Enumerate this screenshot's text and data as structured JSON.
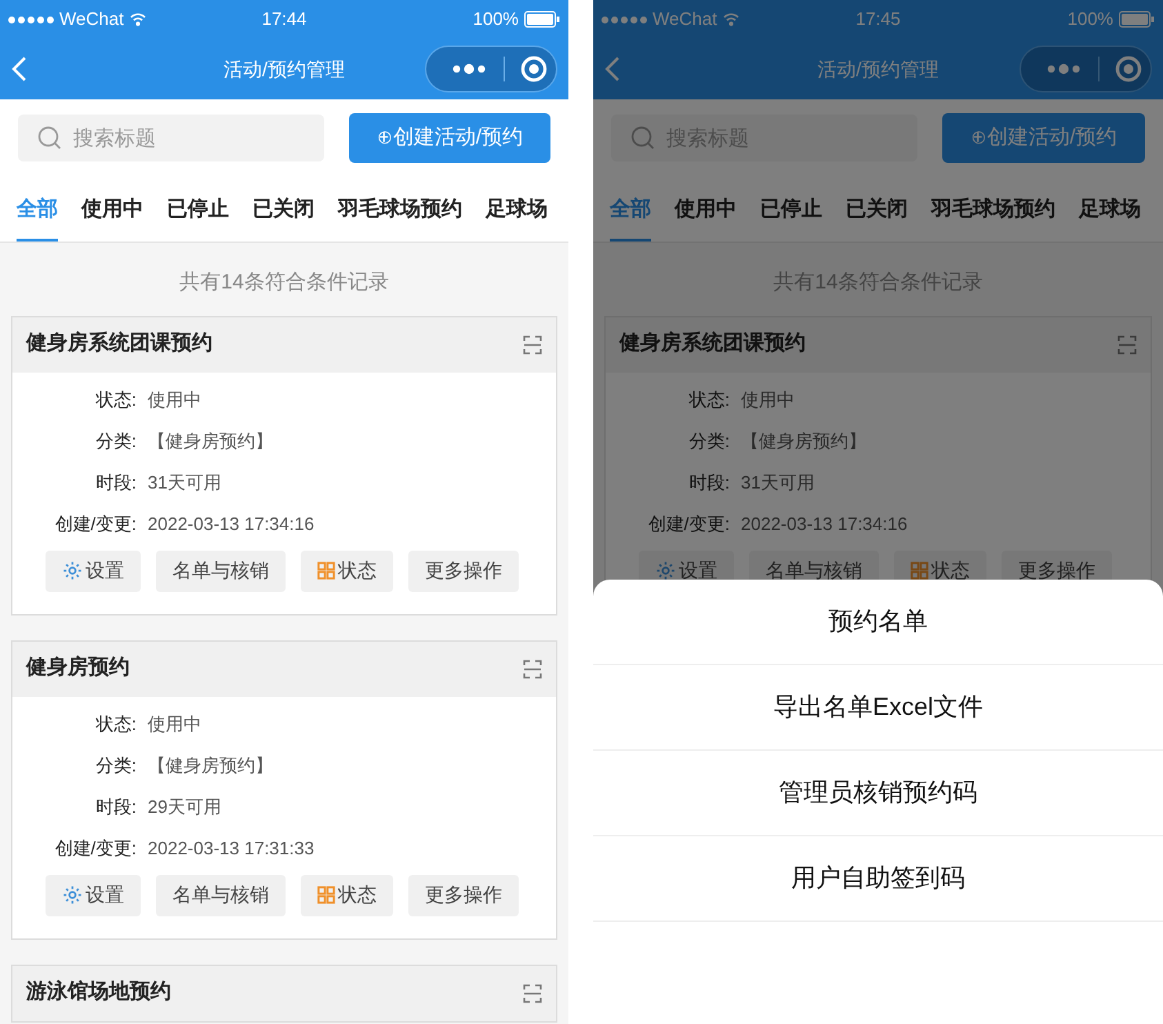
{
  "screens": [
    {
      "status_bar": {
        "carrier": "WeChat",
        "time": "17:44",
        "battery": "100%"
      },
      "nav": {
        "title": "活动/预约管理"
      },
      "search": {
        "placeholder": "搜索标题"
      },
      "create_button": "⊕创建活动/预约",
      "tabs": [
        {
          "label": "全部",
          "selected": true
        },
        {
          "label": "使用中",
          "selected": false
        },
        {
          "label": "已停止",
          "selected": false
        },
        {
          "label": "已关闭",
          "selected": false
        },
        {
          "label": "羽毛球场预约",
          "selected": false
        },
        {
          "label": "足球场",
          "selected": false
        }
      ],
      "count": "共有14条符合条件记录",
      "cards": [
        {
          "title": "健身房系统团课预约",
          "fields": [
            {
              "label": "状态:",
              "value": "使用中"
            },
            {
              "label": "分类:",
              "value": "【健身房预约】"
            },
            {
              "label": "时段:",
              "value": "31天可用"
            },
            {
              "label": "创建/变更:",
              "value": "2022-03-13 17:34:16"
            }
          ],
          "buttons": [
            {
              "kind": "gear",
              "label": "设置"
            },
            {
              "kind": "plain",
              "label": "名单与核销"
            },
            {
              "kind": "grid",
              "label": "状态"
            },
            {
              "kind": "plain",
              "label": "更多操作"
            }
          ]
        },
        {
          "title": "健身房预约",
          "fields": [
            {
              "label": "状态:",
              "value": "使用中"
            },
            {
              "label": "分类:",
              "value": "【健身房预约】"
            },
            {
              "label": "时段:",
              "value": "29天可用"
            },
            {
              "label": "创建/变更:",
              "value": "2022-03-13 17:31:33"
            }
          ],
          "buttons": [
            {
              "kind": "gear",
              "label": "设置"
            },
            {
              "kind": "plain",
              "label": "名单与核销"
            },
            {
              "kind": "grid",
              "label": "状态"
            },
            {
              "kind": "plain",
              "label": "更多操作"
            }
          ]
        },
        {
          "title": "游泳馆场地预约"
        }
      ]
    },
    {
      "status_bar": {
        "carrier": "WeChat",
        "time": "17:45",
        "battery": "100%"
      },
      "nav": {
        "title": "活动/预约管理"
      },
      "search": {
        "placeholder": "搜索标题"
      },
      "create_button": "⊕创建活动/预约",
      "tabs": [
        {
          "label": "全部",
          "selected": true
        },
        {
          "label": "使用中",
          "selected": false
        },
        {
          "label": "已停止",
          "selected": false
        },
        {
          "label": "已关闭",
          "selected": false
        },
        {
          "label": "羽毛球场预约",
          "selected": false
        },
        {
          "label": "足球场",
          "selected": false
        }
      ],
      "count": "共有14条符合条件记录",
      "cards": [
        {
          "title": "健身房系统团课预约",
          "fields": [
            {
              "label": "状态:",
              "value": "使用中"
            },
            {
              "label": "分类:",
              "value": "【健身房预约】"
            },
            {
              "label": "时段:",
              "value": "31天可用"
            },
            {
              "label": "创建/变更:",
              "value": "2022-03-13 17:34:16"
            }
          ],
          "buttons": [
            {
              "kind": "gear",
              "label": "设置"
            },
            {
              "kind": "plain",
              "label": "名单与核销"
            },
            {
              "kind": "grid",
              "label": "状态"
            },
            {
              "kind": "plain",
              "label": "更多操作"
            }
          ]
        }
      ],
      "action_sheet": {
        "items": [
          "预约名单",
          "导出名单Excel文件",
          "管理员核销预约码",
          "用户自助签到码"
        ]
      }
    }
  ]
}
